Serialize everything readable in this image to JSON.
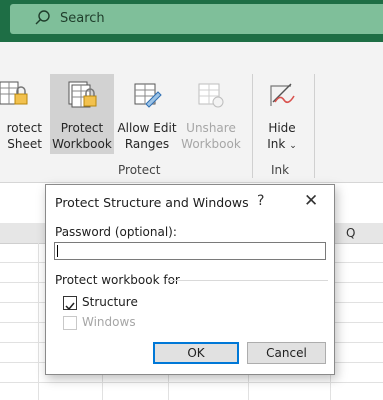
{
  "titlebar": {
    "search_label": "Search"
  },
  "ribbon": {
    "buttons": [
      {
        "line1": "rotect",
        "line2": "Sheet",
        "icon": "protect-sheet-icon"
      },
      {
        "line1": "Protect",
        "line2": "Workbook",
        "icon": "protect-workbook-icon"
      },
      {
        "line1": "Allow Edit",
        "line2": "Ranges",
        "icon": "allow-edit-ranges-icon"
      },
      {
        "line1": "Unshare",
        "line2": "Workbook",
        "icon": "unshare-workbook-icon"
      },
      {
        "line1": "Hide",
        "line2": "Ink",
        "icon": "hide-ink-icon"
      }
    ],
    "groups": [
      "Protect",
      "Ink"
    ]
  },
  "sheet": {
    "column_header": "Q"
  },
  "dialog": {
    "title": "Protect Structure and Windows",
    "help": "?",
    "close": "✕",
    "password_label": "Password (optional):",
    "password_value": "",
    "section_label": "Protect workbook for",
    "structure_label": "Structure",
    "structure_checked": true,
    "windows_label": "Windows",
    "windows_checked": false,
    "ok_label": "OK",
    "cancel_label": "Cancel"
  }
}
